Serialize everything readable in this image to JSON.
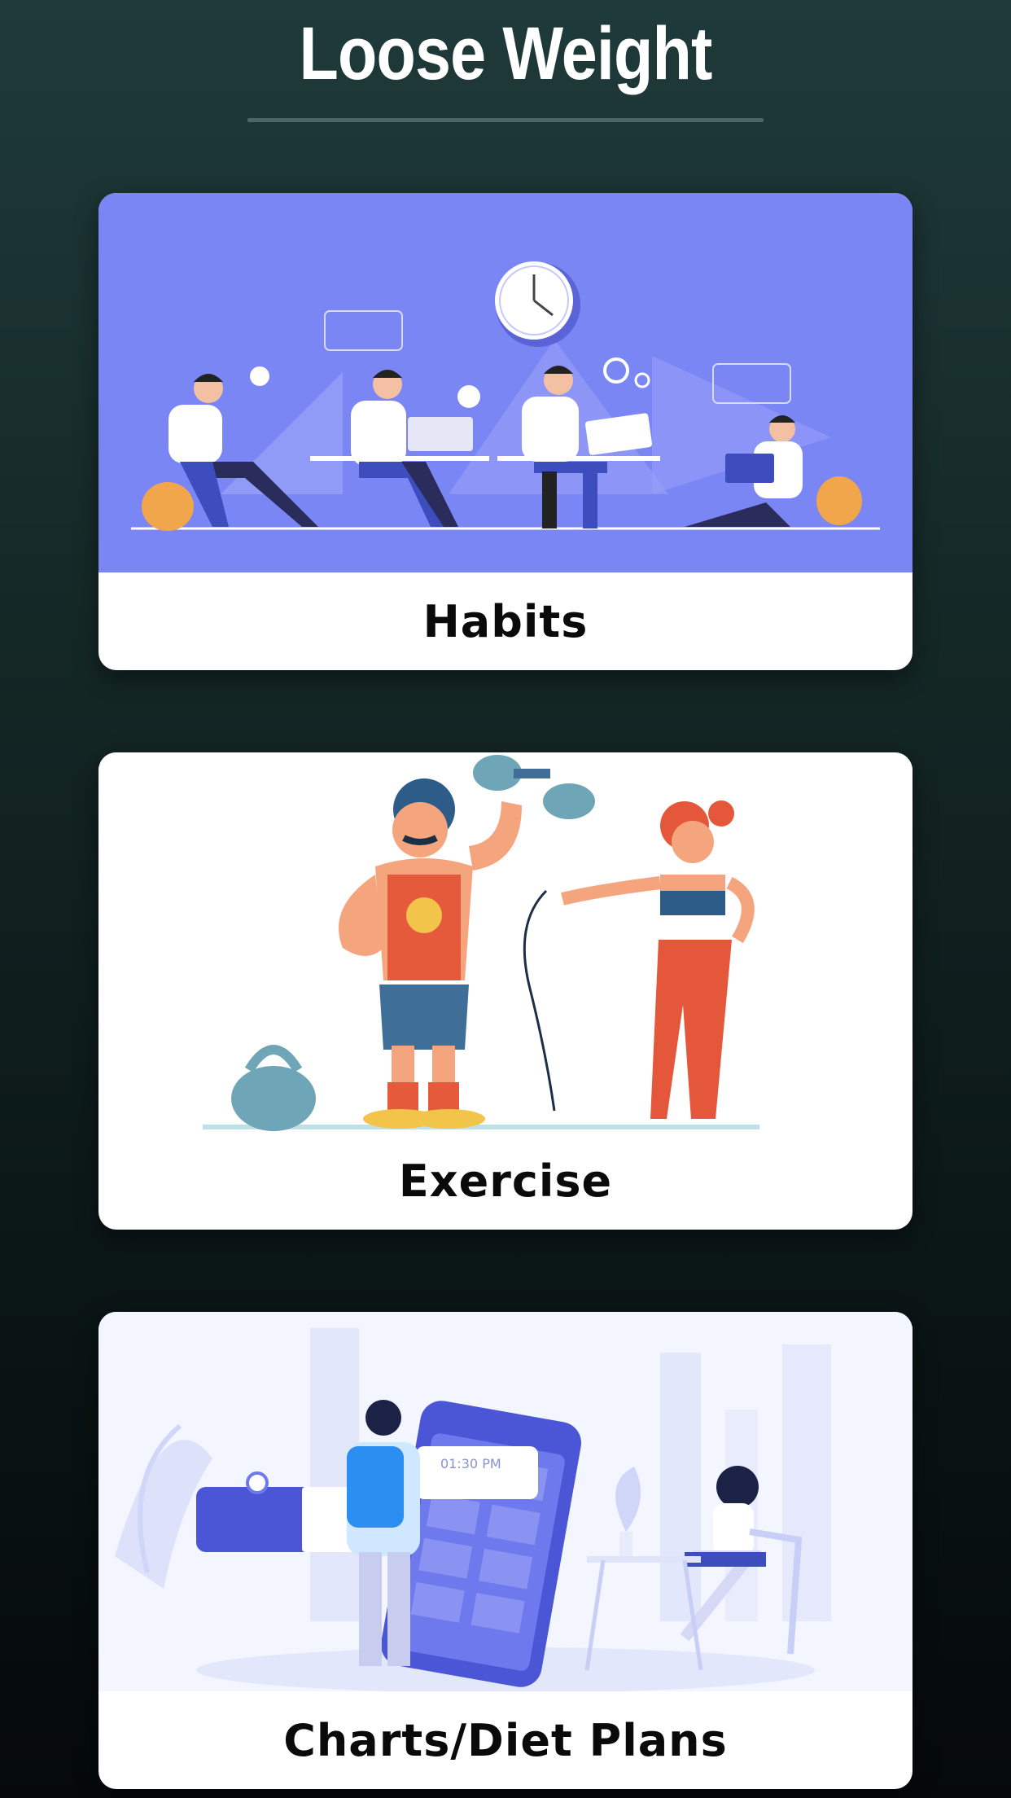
{
  "header": {
    "title": "Loose Weight"
  },
  "cards": [
    {
      "label": "Habits",
      "illustration": "people-working-illustration",
      "bg": "#7b86f5"
    },
    {
      "label": "Exercise",
      "illustration": "fitness-couple-illustration",
      "bg": "#ffffff"
    },
    {
      "label": "Charts/Diet Plans",
      "illustration": "phone-planner-illustration",
      "bg": "#f3f5ff",
      "clock_text": "01:30 PM"
    }
  ],
  "colors": {
    "accent": "#7b86f5",
    "background_top": "#1f3a3a",
    "background_bottom": "#050909",
    "card": "#ffffff"
  }
}
